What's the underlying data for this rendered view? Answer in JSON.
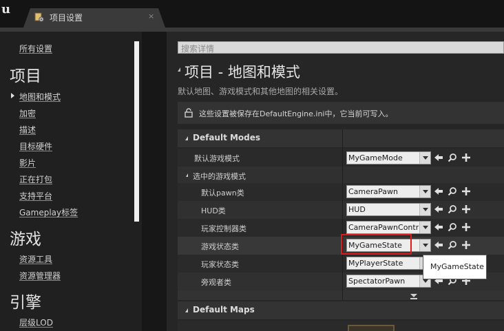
{
  "app": {
    "logo": "u",
    "tab_title": "项目设置",
    "tab_close": "×"
  },
  "nav": {
    "all_settings": "所有设置",
    "project_heading": "项目",
    "project_items": [
      "地图和模式",
      "加密",
      "描述",
      "目标硬件",
      "影片",
      "正在打包",
      "支持平台",
      "Gameplay标签"
    ],
    "game_heading": "游戏",
    "game_items": [
      "资源工具",
      "资源管理器"
    ],
    "engine_heading": "引擎",
    "engine_items": [
      "层级LOD"
    ]
  },
  "search": {
    "placeholder": "搜索详情"
  },
  "page": {
    "title": "项目 - 地图和模式",
    "description": "默认地图、游戏模式和其他地图的相关设置。",
    "notice": "这些设置被保存在DefaultEngine.ini中，它当前可写入。"
  },
  "sections": {
    "default_modes": "Default Modes",
    "default_maps": "Default Maps"
  },
  "rows": {
    "default_game_mode": {
      "label": "默认游戏模式",
      "value": "MyGameMode"
    },
    "selected_game_mode": {
      "label": "选中的游戏模式"
    },
    "default_pawn": {
      "label": "默认pawn类",
      "value": "CameraPawn"
    },
    "hud": {
      "label": "HUD类",
      "value": "HUD"
    },
    "player_controller": {
      "label": "玩家控制器类",
      "value": "CameraPawnControll"
    },
    "game_state": {
      "label": "游戏状态类",
      "value": "MyGameState"
    },
    "player_state": {
      "label": "玩家状态类",
      "value": "MyPlayerState"
    },
    "spectator": {
      "label": "旁观者类",
      "value": "SpectatorPawn"
    }
  },
  "tooltip": {
    "text": "MyGameState"
  },
  "colors": {
    "highlight": "#e0191b",
    "background": "#262626",
    "panel": "#202020"
  },
  "icons": [
    "unreal-logo-icon",
    "settings-tab-icon",
    "lock-icon",
    "use-selected-arrow-icon",
    "browse-magnifier-icon",
    "add-plus-icon",
    "combo-chevron-down-icon",
    "section-collapse-icon",
    "show-more-icon"
  ]
}
